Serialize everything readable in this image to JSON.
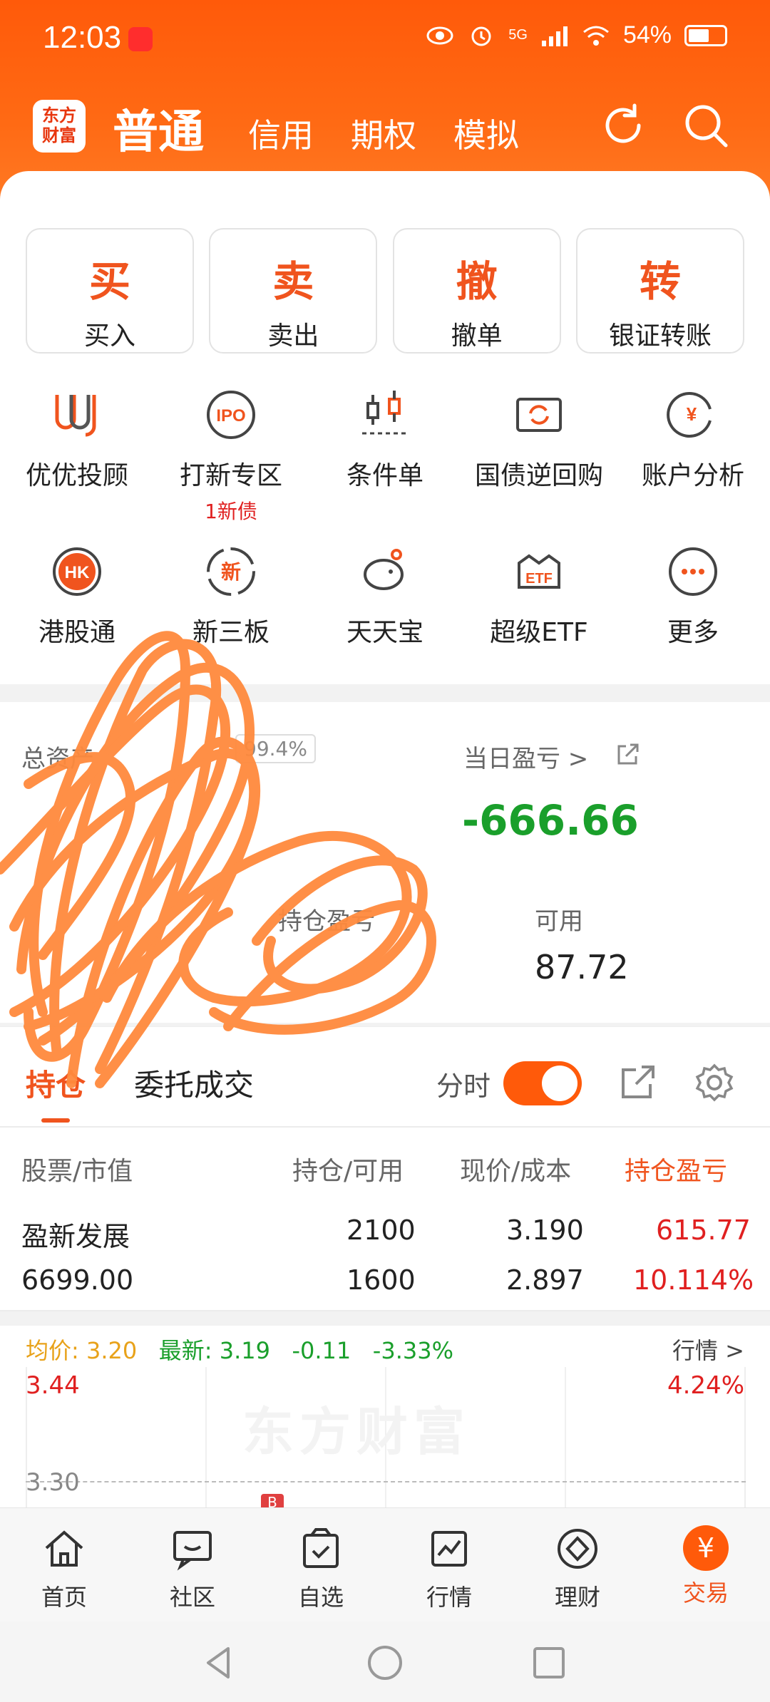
{
  "status_bar": {
    "time": "12:03",
    "signal_label": "5G",
    "battery": "54%"
  },
  "topnav": {
    "logo_line1": "东方",
    "logo_line2": "财富",
    "tabs": [
      "普通",
      "信用",
      "期权",
      "模拟"
    ]
  },
  "quick_actions": [
    {
      "big": "买",
      "small": "买入"
    },
    {
      "big": "卖",
      "small": "卖出"
    },
    {
      "big": "撤",
      "small": "撤单"
    },
    {
      "big": "转",
      "small": "银证转账"
    }
  ],
  "functions_row1": [
    {
      "label": "优优投顾",
      "icon": "uu-advisor-icon"
    },
    {
      "label": "打新专区",
      "icon": "ipo-icon",
      "icon_text": "IPO",
      "sub": "1新债"
    },
    {
      "label": "条件单",
      "icon": "condition-order-icon"
    },
    {
      "label": "国债逆回购",
      "icon": "reverse-repo-icon"
    },
    {
      "label": "账户分析",
      "icon": "account-analysis-icon",
      "icon_text": "¥"
    }
  ],
  "functions_row2": [
    {
      "label": "港股通",
      "icon": "hk-connect-icon",
      "icon_text": "HK"
    },
    {
      "label": "新三板",
      "icon": "new-third-board-icon",
      "icon_text": "新"
    },
    {
      "label": "天天宝",
      "icon": "piggy-bank-icon"
    },
    {
      "label": "超级ETF",
      "icon": "etf-icon",
      "icon_text": "ETF"
    },
    {
      "label": "更多",
      "icon": "more-icon"
    }
  ],
  "assets": {
    "total_label": "总资产",
    "ratio": "99.4%",
    "pnl_label": "当日盈亏 >",
    "pnl_value": "-666.66",
    "hold_pnl_label": "持仓盈亏",
    "available_label": "可用",
    "available_value": "87.72"
  },
  "holding_tabs": {
    "tab1": "持仓",
    "tab2": "委托成交",
    "intraday_label": "分时",
    "intraday_on": true
  },
  "table": {
    "headers": [
      "股票/市值",
      "持仓/可用",
      "现价/成本",
      "持仓盈亏"
    ],
    "rows": [
      {
        "name": "盈新发展",
        "market_value": "6699.00",
        "position": "2100",
        "available": "1600",
        "price": "3.190",
        "cost": "2.897",
        "pnl": "615.77",
        "pnl_pct": "10.114%"
      }
    ]
  },
  "minichart": {
    "avg_label": "均价:",
    "avg_value": "3.20",
    "latest_label": "最新:",
    "latest_value": "3.19",
    "change": "-0.11",
    "change_pct": "-3.33%",
    "market_link": "行情 >",
    "high_price": "3.44",
    "high_pct": "4.24%",
    "mid_price": "3.30",
    "watermark": "东方财富",
    "marker": "B"
  },
  "bottom_nav": [
    {
      "label": "首页",
      "icon": "home-icon"
    },
    {
      "label": "社区",
      "icon": "community-icon"
    },
    {
      "label": "自选",
      "icon": "watchlist-icon"
    },
    {
      "label": "行情",
      "icon": "market-icon"
    },
    {
      "label": "理财",
      "icon": "wealth-icon"
    },
    {
      "label": "交易",
      "icon": "trade-icon",
      "active": true,
      "icon_text": "¥"
    }
  ],
  "colors": {
    "brand": "#ff5a0a",
    "up": "#e02020",
    "down": "#1a9f2b",
    "avg_line": "#e8a21a"
  }
}
